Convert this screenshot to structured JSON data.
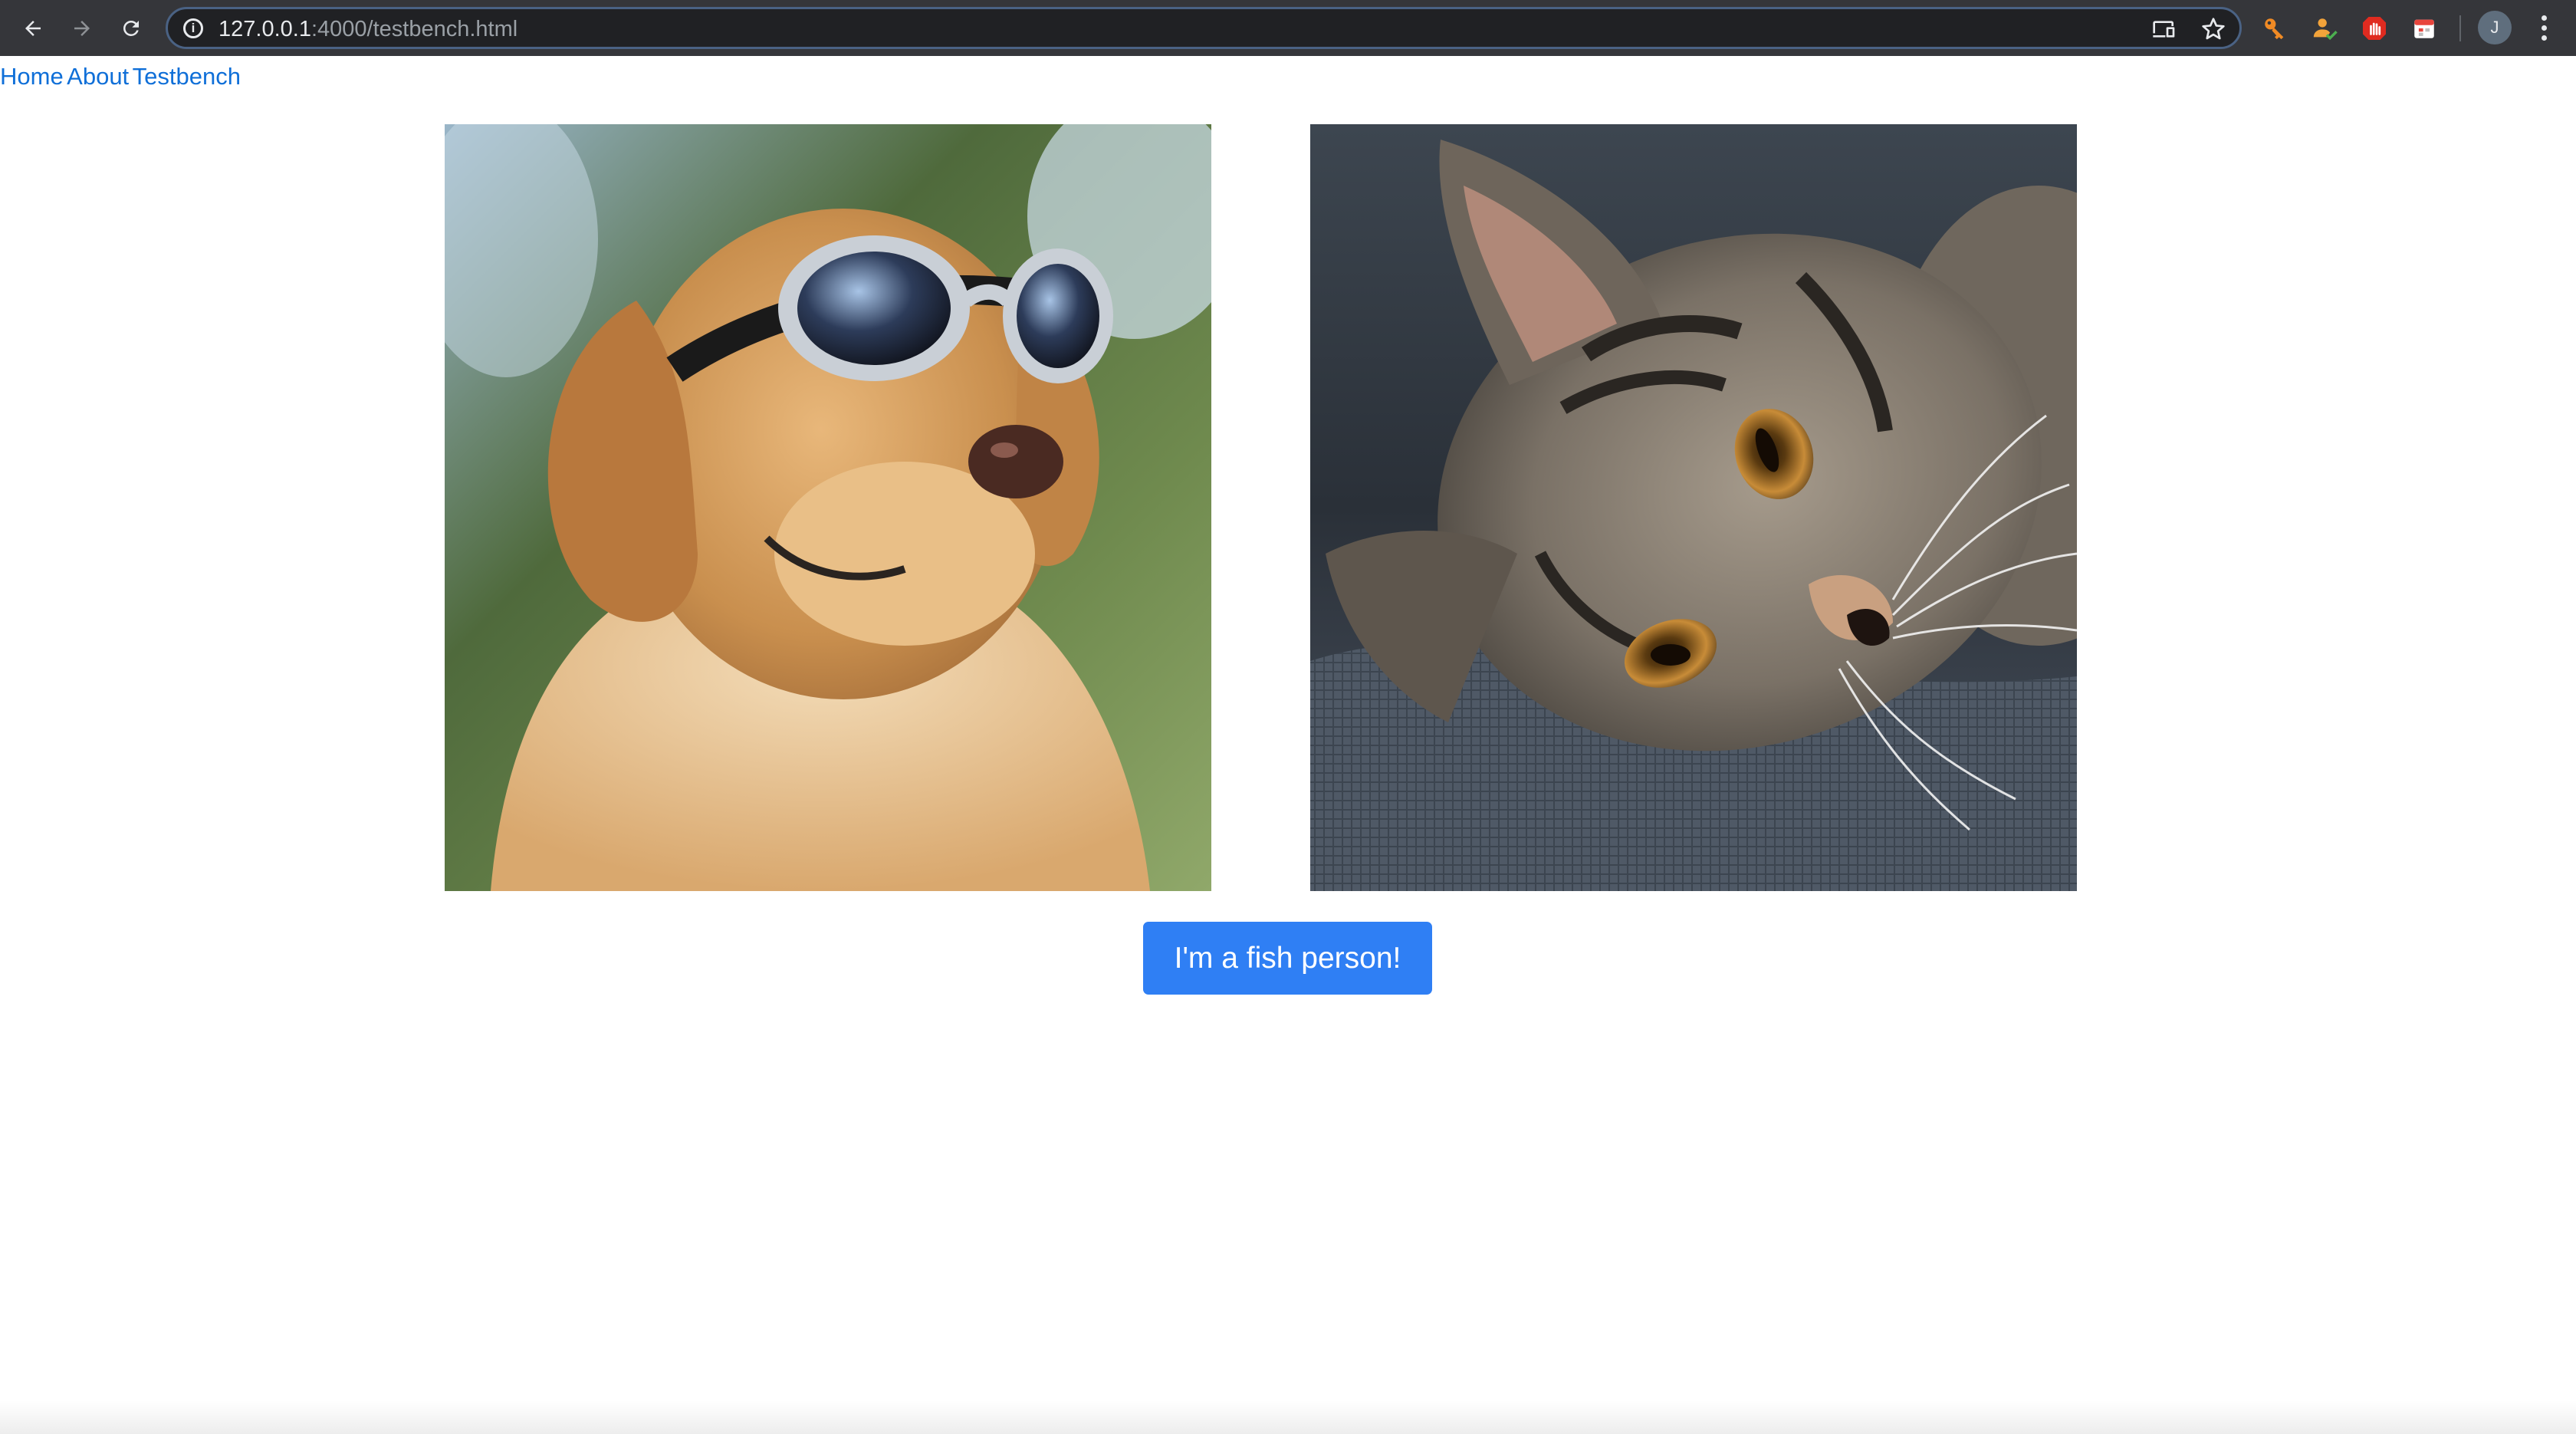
{
  "browser": {
    "url_host": "127.0.0.1",
    "url_rest": ":4000/testbench.html",
    "profile_initial": "J",
    "toolbar_icons": [
      "back-arrow-icon",
      "forward-arrow-icon",
      "reload-icon",
      "info-icon",
      "cast-icon",
      "star-icon",
      "key-extension-icon",
      "person-check-extension-icon",
      "stop-hand-extension-icon",
      "calendar-extension-icon",
      "more-vert-icon"
    ]
  },
  "nav": {
    "home": "Home",
    "about": "About",
    "testbench": "Testbench"
  },
  "images": [
    {
      "name": "dog-with-goggles"
    },
    {
      "name": "tabby-kitten"
    }
  ],
  "button": {
    "label": "I'm a fish person!",
    "color": "#2f7ff4"
  },
  "colors": {
    "link": "#0f6fd8",
    "chrome_dark": "#35363a",
    "omnibox": "#202124"
  }
}
